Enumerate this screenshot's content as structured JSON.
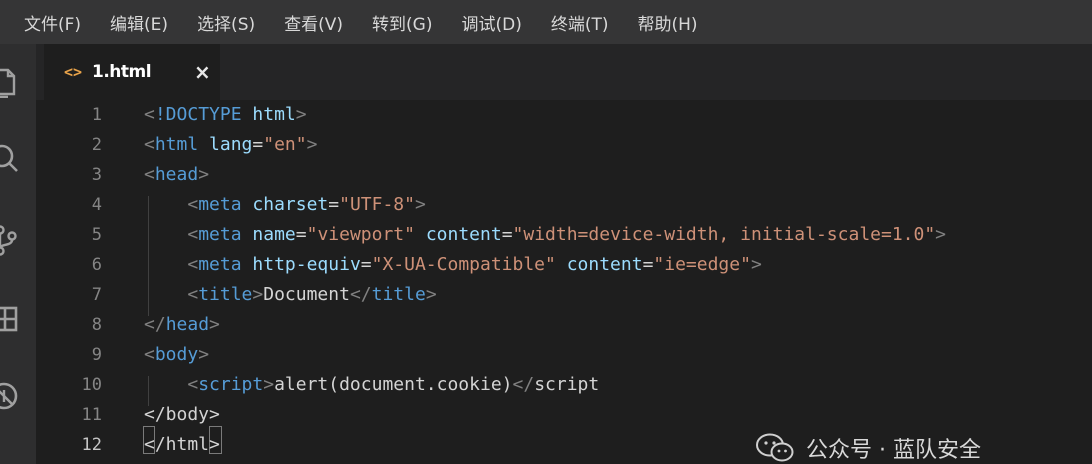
{
  "menu": [
    "文件(F)",
    "编辑(E)",
    "选择(S)",
    "查看(V)",
    "转到(G)",
    "调试(D)",
    "终端(T)",
    "帮助(H)"
  ],
  "activity_icons": [
    "files-icon",
    "search-icon",
    "source-control-icon",
    "extensions-icon",
    "debug-icon"
  ],
  "tab": {
    "icon": "<>",
    "label": "1.html",
    "close": "×"
  },
  "editor": {
    "active_line": 12,
    "line_numbers": [
      "1",
      "2",
      "3",
      "4",
      "5",
      "6",
      "7",
      "8",
      "9",
      "10",
      "11",
      "12"
    ],
    "lines": [
      [
        {
          "t": "<",
          "c": "tag"
        },
        {
          "t": "!DOCTYPE",
          "c": "kw"
        },
        {
          "t": " ",
          "c": "txt"
        },
        {
          "t": "html",
          "c": "attr"
        },
        {
          "t": ">",
          "c": "tag"
        }
      ],
      [
        {
          "t": "<",
          "c": "tag"
        },
        {
          "t": "html",
          "c": "kw"
        },
        {
          "t": " ",
          "c": "txt"
        },
        {
          "t": "lang",
          "c": "attr"
        },
        {
          "t": "=",
          "c": "txt"
        },
        {
          "t": "\"en\"",
          "c": "str"
        },
        {
          "t": ">",
          "c": "tag"
        }
      ],
      [
        {
          "t": "<",
          "c": "tag"
        },
        {
          "t": "head",
          "c": "kw"
        },
        {
          "t": ">",
          "c": "tag"
        }
      ],
      [
        {
          "t": "    ",
          "c": "txt"
        },
        {
          "t": "<",
          "c": "tag"
        },
        {
          "t": "meta",
          "c": "kw"
        },
        {
          "t": " ",
          "c": "txt"
        },
        {
          "t": "charset",
          "c": "attr"
        },
        {
          "t": "=",
          "c": "txt"
        },
        {
          "t": "\"UTF-8\"",
          "c": "str"
        },
        {
          "t": ">",
          "c": "tag"
        }
      ],
      [
        {
          "t": "    ",
          "c": "txt"
        },
        {
          "t": "<",
          "c": "tag"
        },
        {
          "t": "meta",
          "c": "kw"
        },
        {
          "t": " ",
          "c": "txt"
        },
        {
          "t": "name",
          "c": "attr"
        },
        {
          "t": "=",
          "c": "txt"
        },
        {
          "t": "\"viewport\"",
          "c": "str"
        },
        {
          "t": " ",
          "c": "txt"
        },
        {
          "t": "content",
          "c": "attr"
        },
        {
          "t": "=",
          "c": "txt"
        },
        {
          "t": "\"width=device-width, initial-scale=1.0\"",
          "c": "str"
        },
        {
          "t": ">",
          "c": "tag"
        }
      ],
      [
        {
          "t": "    ",
          "c": "txt"
        },
        {
          "t": "<",
          "c": "tag"
        },
        {
          "t": "meta",
          "c": "kw"
        },
        {
          "t": " ",
          "c": "txt"
        },
        {
          "t": "http-equiv",
          "c": "attr"
        },
        {
          "t": "=",
          "c": "txt"
        },
        {
          "t": "\"X-UA-Compatible\"",
          "c": "str"
        },
        {
          "t": " ",
          "c": "txt"
        },
        {
          "t": "content",
          "c": "attr"
        },
        {
          "t": "=",
          "c": "txt"
        },
        {
          "t": "\"ie=edge\"",
          "c": "str"
        },
        {
          "t": ">",
          "c": "tag"
        }
      ],
      [
        {
          "t": "    ",
          "c": "txt"
        },
        {
          "t": "<",
          "c": "tag"
        },
        {
          "t": "title",
          "c": "kw"
        },
        {
          "t": ">",
          "c": "tag"
        },
        {
          "t": "Document",
          "c": "txt"
        },
        {
          "t": "</",
          "c": "tag"
        },
        {
          "t": "title",
          "c": "kw"
        },
        {
          "t": ">",
          "c": "tag"
        }
      ],
      [
        {
          "t": "</",
          "c": "tag"
        },
        {
          "t": "head",
          "c": "kw"
        },
        {
          "t": ">",
          "c": "tag"
        }
      ],
      [
        {
          "t": "<",
          "c": "tag"
        },
        {
          "t": "body",
          "c": "kw"
        },
        {
          "t": ">",
          "c": "tag"
        }
      ],
      [
        {
          "t": "    ",
          "c": "txt"
        },
        {
          "t": "<",
          "c": "tag"
        },
        {
          "t": "script",
          "c": "kw"
        },
        {
          "t": ">",
          "c": "tag"
        },
        {
          "t": "alert(document.cookie)",
          "c": "txt"
        },
        {
          "t": "</",
          "c": "tag"
        },
        {
          "t": "script",
          "c": "txt"
        }
      ],
      [
        {
          "t": "</body>",
          "c": "txt"
        }
      ],
      [
        {
          "t": "</html>",
          "c": "txt"
        }
      ]
    ]
  },
  "colors": {
    "tag": "#808080",
    "kw": "#569cd6",
    "attr": "#9cdcfe",
    "str": "#ce9178",
    "txt": "#d4d4d4",
    "accent": "#e8a34a"
  },
  "watermark": {
    "text": "公众号 · 蓝队安全",
    "icon": "wechat-icon"
  }
}
